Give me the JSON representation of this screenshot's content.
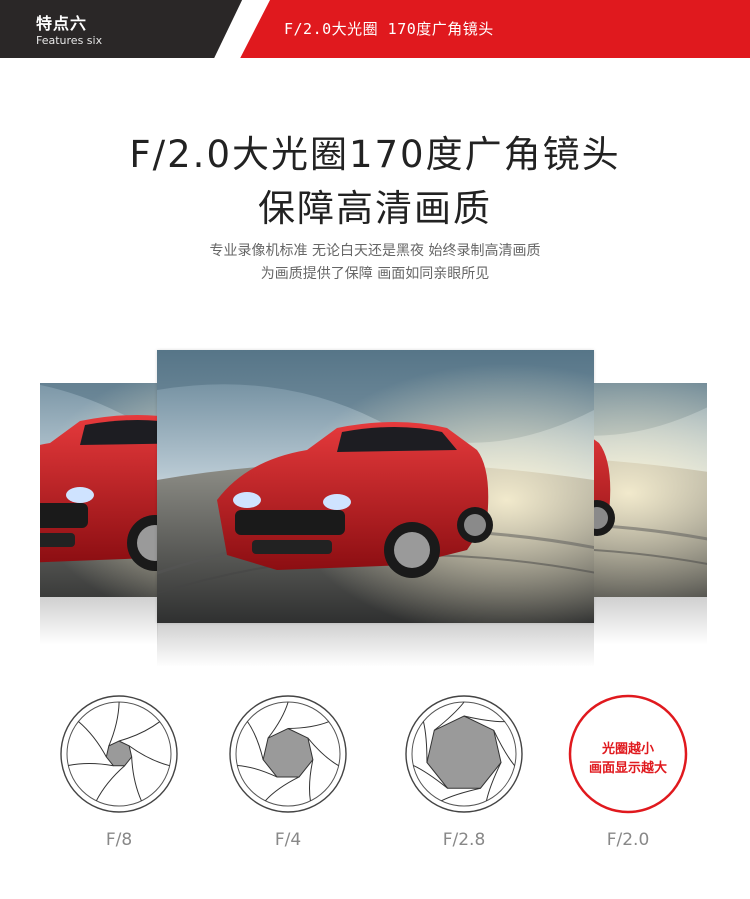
{
  "header": {
    "feature_title": "特点六",
    "feature_subtitle": "Features six",
    "banner_text": "F/2.0大光圈  170度广角镜头"
  },
  "hero": {
    "title_line1": "F/2.0大光圈170度广角镜头",
    "title_line2": "保障高清画质",
    "desc_line1": "专业录像机标准 无论白天还是黑夜 始终录制高清画质",
    "desc_line2": "为画质提供了保障 画面如同亲眼所见"
  },
  "apertures": [
    {
      "label": "F/8",
      "opening": 0.1
    },
    {
      "label": "F/4",
      "opening": 0.35
    },
    {
      "label": "F/2.8",
      "opening": 0.6
    }
  ],
  "badge": {
    "label": "F/2.0",
    "line1": "光圈越小",
    "line2": "画面显示越大"
  },
  "colors": {
    "accent": "#e0191e",
    "dark": "#2a2727",
    "car": "#c8161d"
  }
}
